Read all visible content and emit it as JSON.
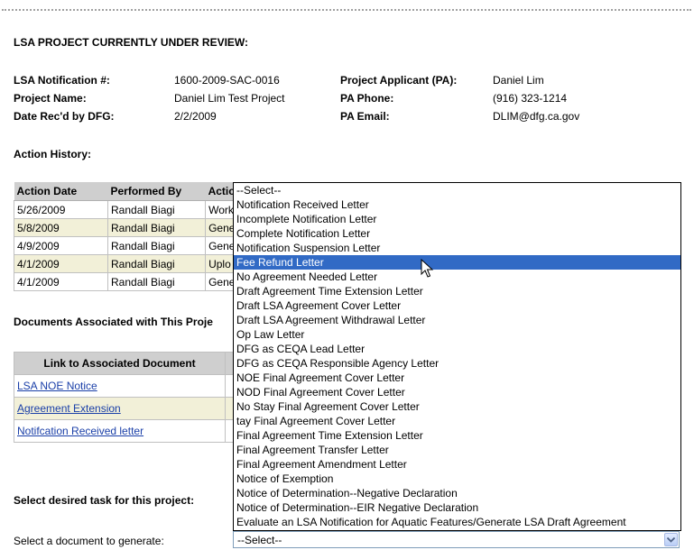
{
  "review": {
    "heading": "LSA PROJECT CURRENTLY UNDER REVIEW:",
    "notification_label": "LSA Notification #:",
    "notification_value": "1600-2009-SAC-0016",
    "project_name_label": "Project Name:",
    "project_name_value": "Daniel Lim Test Project",
    "date_label": "Date Rec'd by DFG:",
    "date_value": "2/2/2009",
    "applicant_label": "Project Applicant (PA):",
    "applicant_value": "Daniel Lim",
    "phone_label": "PA Phone:",
    "phone_value": "(916) 323-1214",
    "email_label": "PA Email:",
    "email_value": "DLIM@dfg.ca.gov"
  },
  "history": {
    "heading": "Action History:",
    "columns": [
      "Action Date",
      "Performed By",
      "Actio"
    ],
    "rows": [
      {
        "date": "5/26/2009",
        "by": "Randall Biagi",
        "action": "Work"
      },
      {
        "date": "5/8/2009",
        "by": "Randall Biagi",
        "action": "Gene"
      },
      {
        "date": "4/9/2009",
        "by": "Randall Biagi",
        "action": "Gene"
      },
      {
        "date": "4/1/2009",
        "by": "Randall Biagi",
        "action": "Uplo"
      },
      {
        "date": "4/1/2009",
        "by": "Randall Biagi",
        "action": "Gene"
      }
    ]
  },
  "documents": {
    "heading": "Documents Associated with This Proje",
    "column": "Link to Associated Document",
    "links": [
      "LSA NOE Notice",
      "Agreement Extension",
      "Notifcation Received letter"
    ]
  },
  "task": {
    "heading": "Select desired task for this project:",
    "doc_label": "Select a document to generate:",
    "selected_value": "--Select--"
  },
  "dropdown": {
    "highlighted_index": 5,
    "options": [
      "--Select--",
      "Notification Received Letter",
      "Incomplete Notification Letter",
      "Complete Notification Letter",
      "Notification Suspension Letter",
      "Fee Refund Letter",
      "No Agreement Needed Letter",
      "Draft Agreement Time Extension Letter",
      "Draft LSA Agreement Cover Letter",
      "Draft LSA Agreement Withdrawal Letter",
      "Op Law Letter",
      "DFG as CEQA Lead Letter",
      "DFG as CEQA Responsible Agency Letter",
      "NOE Final Agreement Cover Letter",
      "NOD Final Agreement Cover Letter",
      "No Stay Final Agreement Cover Letter",
      "tay Final Agreement Cover Letter",
      "Final Agreement Time Extension Letter",
      "Final Agreement Transfer Letter",
      "Final Agreement Amendment Letter",
      "Notice of Exemption",
      "Notice of Determination--Negative Declaration",
      "Notice of Determination--EIR Negative Declaration",
      "Evaluate an LSA Notification for Aquatic Features/Generate LSA Draft Agreement"
    ]
  },
  "colors": {
    "highlight": "#316ac5",
    "row_alt": "#f2f0d8",
    "header_bg": "#cfcfcf",
    "link": "#1a3fa8"
  }
}
